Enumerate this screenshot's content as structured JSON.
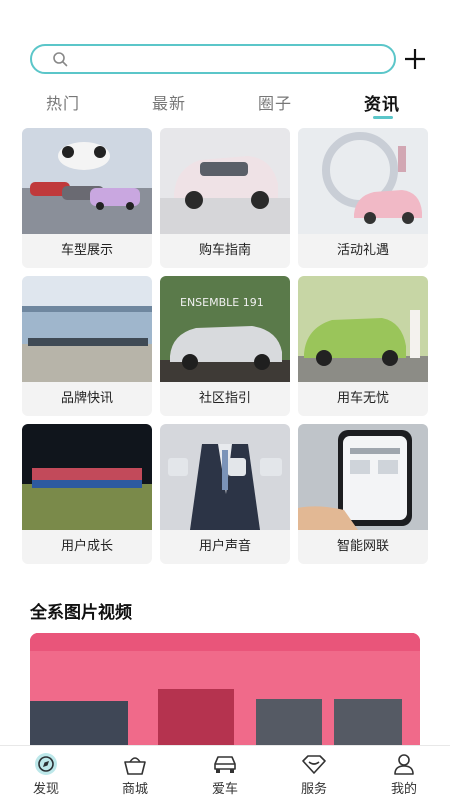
{
  "search": {
    "placeholder": ""
  },
  "tabs": [
    {
      "label": "热门",
      "active": false
    },
    {
      "label": "最新",
      "active": false
    },
    {
      "label": "圈子",
      "active": false
    },
    {
      "label": "资讯",
      "active": true
    }
  ],
  "grid": [
    {
      "label": "车型展示"
    },
    {
      "label": "购车指南"
    },
    {
      "label": "活动礼遇"
    },
    {
      "label": "品牌快讯"
    },
    {
      "label": "社区指引"
    },
    {
      "label": "用车无忧"
    },
    {
      "label": "用户成长"
    },
    {
      "label": "用户声音"
    },
    {
      "label": "智能网联"
    }
  ],
  "section": {
    "title": "全系图片视频"
  },
  "storefront_sign": "ENSEMBLE 191",
  "bottom_nav": [
    {
      "label": "发现",
      "icon": "discover-icon"
    },
    {
      "label": "商城",
      "icon": "shop-basket-icon"
    },
    {
      "label": "爱车",
      "icon": "car-icon"
    },
    {
      "label": "服务",
      "icon": "service-icon"
    },
    {
      "label": "我的",
      "icon": "profile-icon"
    }
  ],
  "colors": {
    "accent": "#5bc6c9",
    "banner": "#f06a8a"
  }
}
